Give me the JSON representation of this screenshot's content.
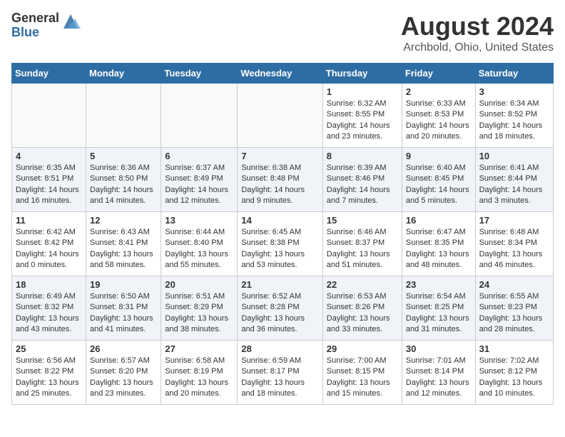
{
  "header": {
    "logo_general": "General",
    "logo_blue": "Blue",
    "title": "August 2024",
    "subtitle": "Archbold, Ohio, United States"
  },
  "days_of_week": [
    "Sunday",
    "Monday",
    "Tuesday",
    "Wednesday",
    "Thursday",
    "Friday",
    "Saturday"
  ],
  "weeks": [
    [
      {
        "day": "",
        "info": ""
      },
      {
        "day": "",
        "info": ""
      },
      {
        "day": "",
        "info": ""
      },
      {
        "day": "",
        "info": ""
      },
      {
        "day": "1",
        "info": "Sunrise: 6:32 AM\nSunset: 8:55 PM\nDaylight: 14 hours and 23 minutes."
      },
      {
        "day": "2",
        "info": "Sunrise: 6:33 AM\nSunset: 8:53 PM\nDaylight: 14 hours and 20 minutes."
      },
      {
        "day": "3",
        "info": "Sunrise: 6:34 AM\nSunset: 8:52 PM\nDaylight: 14 hours and 18 minutes."
      }
    ],
    [
      {
        "day": "4",
        "info": "Sunrise: 6:35 AM\nSunset: 8:51 PM\nDaylight: 14 hours and 16 minutes."
      },
      {
        "day": "5",
        "info": "Sunrise: 6:36 AM\nSunset: 8:50 PM\nDaylight: 14 hours and 14 minutes."
      },
      {
        "day": "6",
        "info": "Sunrise: 6:37 AM\nSunset: 8:49 PM\nDaylight: 14 hours and 12 minutes."
      },
      {
        "day": "7",
        "info": "Sunrise: 6:38 AM\nSunset: 8:48 PM\nDaylight: 14 hours and 9 minutes."
      },
      {
        "day": "8",
        "info": "Sunrise: 6:39 AM\nSunset: 8:46 PM\nDaylight: 14 hours and 7 minutes."
      },
      {
        "day": "9",
        "info": "Sunrise: 6:40 AM\nSunset: 8:45 PM\nDaylight: 14 hours and 5 minutes."
      },
      {
        "day": "10",
        "info": "Sunrise: 6:41 AM\nSunset: 8:44 PM\nDaylight: 14 hours and 3 minutes."
      }
    ],
    [
      {
        "day": "11",
        "info": "Sunrise: 6:42 AM\nSunset: 8:42 PM\nDaylight: 14 hours and 0 minutes."
      },
      {
        "day": "12",
        "info": "Sunrise: 6:43 AM\nSunset: 8:41 PM\nDaylight: 13 hours and 58 minutes."
      },
      {
        "day": "13",
        "info": "Sunrise: 6:44 AM\nSunset: 8:40 PM\nDaylight: 13 hours and 55 minutes."
      },
      {
        "day": "14",
        "info": "Sunrise: 6:45 AM\nSunset: 8:38 PM\nDaylight: 13 hours and 53 minutes."
      },
      {
        "day": "15",
        "info": "Sunrise: 6:46 AM\nSunset: 8:37 PM\nDaylight: 13 hours and 51 minutes."
      },
      {
        "day": "16",
        "info": "Sunrise: 6:47 AM\nSunset: 8:35 PM\nDaylight: 13 hours and 48 minutes."
      },
      {
        "day": "17",
        "info": "Sunrise: 6:48 AM\nSunset: 8:34 PM\nDaylight: 13 hours and 46 minutes."
      }
    ],
    [
      {
        "day": "18",
        "info": "Sunrise: 6:49 AM\nSunset: 8:32 PM\nDaylight: 13 hours and 43 minutes."
      },
      {
        "day": "19",
        "info": "Sunrise: 6:50 AM\nSunset: 8:31 PM\nDaylight: 13 hours and 41 minutes."
      },
      {
        "day": "20",
        "info": "Sunrise: 6:51 AM\nSunset: 8:29 PM\nDaylight: 13 hours and 38 minutes."
      },
      {
        "day": "21",
        "info": "Sunrise: 6:52 AM\nSunset: 8:28 PM\nDaylight: 13 hours and 36 minutes."
      },
      {
        "day": "22",
        "info": "Sunrise: 6:53 AM\nSunset: 8:26 PM\nDaylight: 13 hours and 33 minutes."
      },
      {
        "day": "23",
        "info": "Sunrise: 6:54 AM\nSunset: 8:25 PM\nDaylight: 13 hours and 31 minutes."
      },
      {
        "day": "24",
        "info": "Sunrise: 6:55 AM\nSunset: 8:23 PM\nDaylight: 13 hours and 28 minutes."
      }
    ],
    [
      {
        "day": "25",
        "info": "Sunrise: 6:56 AM\nSunset: 8:22 PM\nDaylight: 13 hours and 25 minutes."
      },
      {
        "day": "26",
        "info": "Sunrise: 6:57 AM\nSunset: 8:20 PM\nDaylight: 13 hours and 23 minutes."
      },
      {
        "day": "27",
        "info": "Sunrise: 6:58 AM\nSunset: 8:19 PM\nDaylight: 13 hours and 20 minutes."
      },
      {
        "day": "28",
        "info": "Sunrise: 6:59 AM\nSunset: 8:17 PM\nDaylight: 13 hours and 18 minutes."
      },
      {
        "day": "29",
        "info": "Sunrise: 7:00 AM\nSunset: 8:15 PM\nDaylight: 13 hours and 15 minutes."
      },
      {
        "day": "30",
        "info": "Sunrise: 7:01 AM\nSunset: 8:14 PM\nDaylight: 13 hours and 12 minutes."
      },
      {
        "day": "31",
        "info": "Sunrise: 7:02 AM\nSunset: 8:12 PM\nDaylight: 13 hours and 10 minutes."
      }
    ]
  ]
}
